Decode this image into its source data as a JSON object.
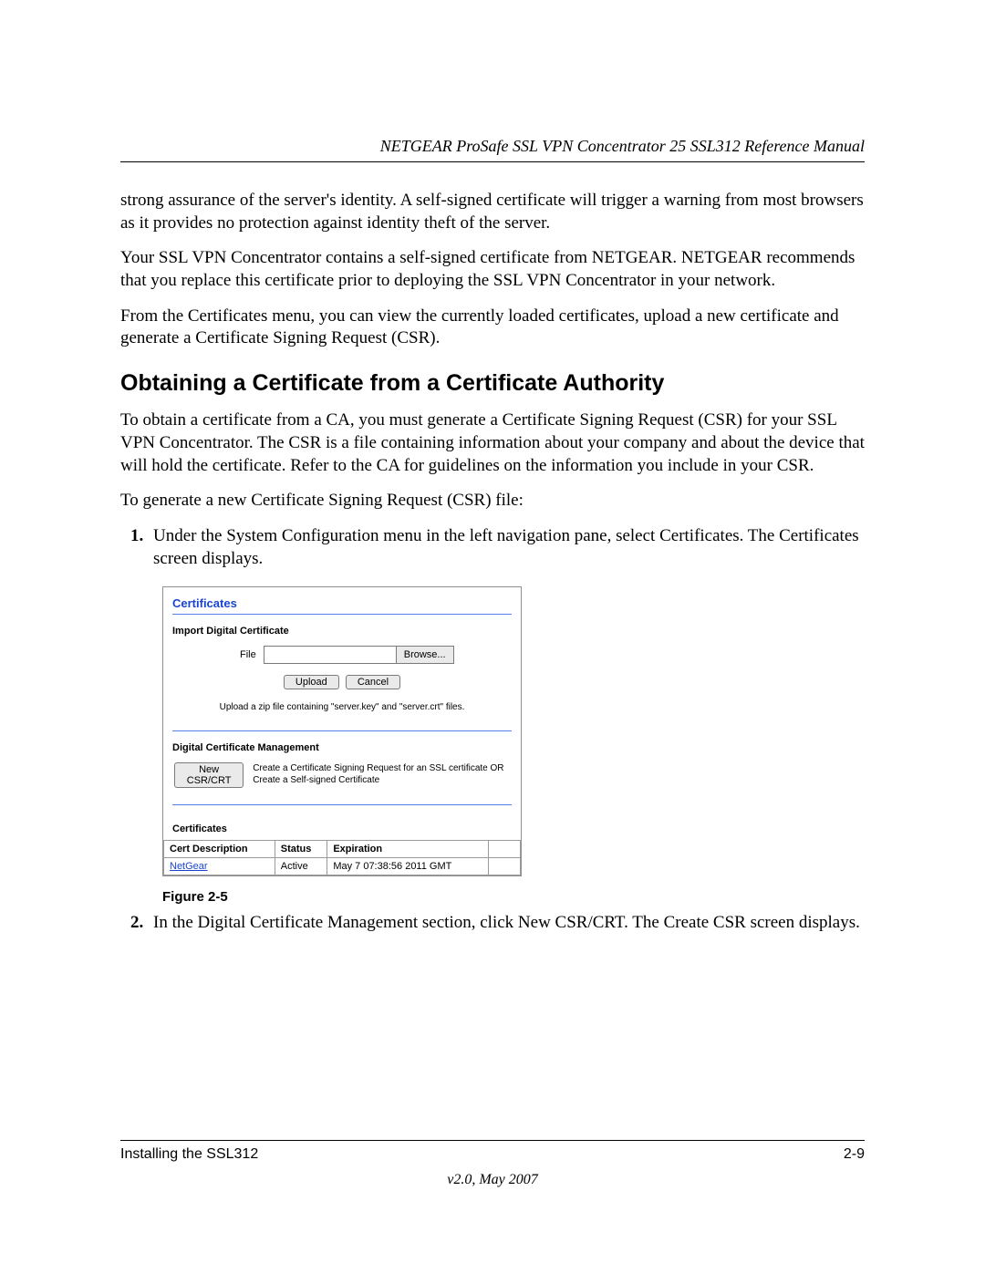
{
  "header": {
    "running": "NETGEAR ProSafe SSL VPN Concentrator 25 SSL312 Reference Manual"
  },
  "paragraphs": {
    "p1": "strong assurance of the server's identity. A self-signed certificate will trigger a warning from most browsers as it provides no protection against identity theft of the server.",
    "p2": "Your SSL VPN Concentrator contains a self-signed certificate from NETGEAR. NETGEAR recommends that you replace this certificate prior to deploying the SSL VPN Concentrator in your network.",
    "p3": "From the Certificates menu, you can view the currently loaded certificates, upload a new certificate and generate a Certificate Signing Request (CSR).",
    "h2": "Obtaining a Certificate from a Certificate Authority",
    "p4": "To obtain a certificate from a CA, you must generate a Certificate Signing Request (CSR) for your SSL VPN Concentrator. The CSR is a file containing information about your company and about the device that will hold the certificate. Refer to the CA for guidelines on the information you include in your CSR.",
    "p5": "To generate a new Certificate Signing Request (CSR) file:"
  },
  "steps": [
    "Under the System Configuration menu in the left navigation pane, select Certificates. The Certificates screen displays.",
    "In the Digital Certificate Management section, click New CSR/CRT. The Create CSR screen displays."
  ],
  "screenshot": {
    "title": "Certificates",
    "import_section": "Import Digital Certificate",
    "file_label": "File",
    "browse": "Browse...",
    "upload": "Upload",
    "cancel": "Cancel",
    "hint": "Upload a zip file containing \"server.key\" and \"server.crt\" files.",
    "mgmt_section": "Digital Certificate Management",
    "new_csr": "New CSR/CRT",
    "mgmt_text": "Create a Certificate Signing Request for an SSL certificate OR Create a Self-signed Certificate",
    "table_title": "Certificates",
    "table_headers": {
      "desc": "Cert Description",
      "status": "Status",
      "exp": "Expiration"
    },
    "table_row": {
      "desc": "NetGear",
      "status": "Active",
      "exp": "May 7 07:38:56 2011 GMT"
    }
  },
  "figure_caption": "Figure 2-5",
  "footer": {
    "left": "Installing the SSL312",
    "right": "2-9",
    "version": "v2.0, May 2007"
  }
}
